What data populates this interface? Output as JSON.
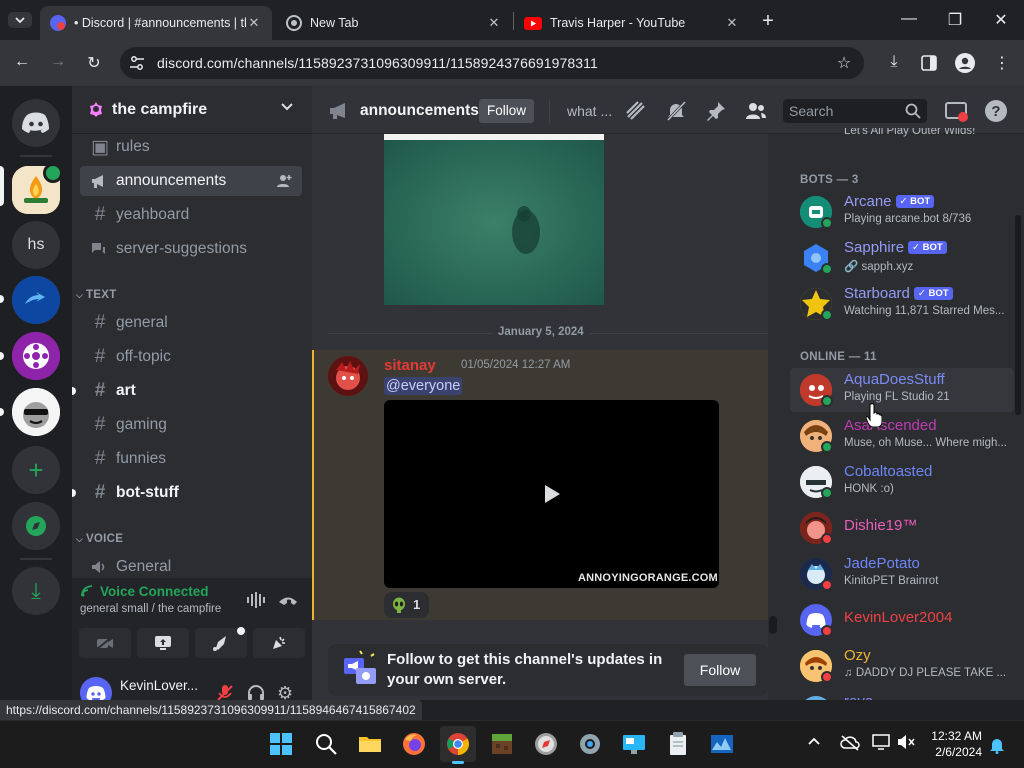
{
  "browser": {
    "tabs": [
      {
        "title": "• Discord | #announcements | the campfire",
        "active": true
      },
      {
        "title": "New Tab",
        "active": false
      },
      {
        "title": "Travis Harper - YouTube",
        "active": false
      }
    ],
    "url": "discord.com/channels/1158923731096309911/1158924376691978311",
    "hover_link": "https://discord.com/channels/1158923731096309911/1158946467415867402"
  },
  "server": {
    "name": "the campfire",
    "guild_labels": [
      "hs"
    ]
  },
  "channels": {
    "top": [
      {
        "name": "rules",
        "icon": "rules-icon"
      },
      {
        "name": "announcements",
        "icon": "megaphone-icon",
        "selected": true
      },
      {
        "name": "yeahboard",
        "icon": "hash-icon"
      },
      {
        "name": "server-suggestions",
        "icon": "forum-icon"
      }
    ],
    "text_category": "TEXT",
    "text": [
      {
        "name": "general",
        "unread": false
      },
      {
        "name": "off-topic",
        "unread": false
      },
      {
        "name": "art",
        "unread": true
      },
      {
        "name": "gaming",
        "unread": false
      },
      {
        "name": "funnies",
        "unread": false
      },
      {
        "name": "bot-stuff",
        "unread": true
      }
    ],
    "voice_category": "VOICE",
    "voice": [
      {
        "name": "General"
      }
    ]
  },
  "voice_status": {
    "title": "Voice Connected",
    "subtitle": "general small / the campfire"
  },
  "user": {
    "name": "KevinLover..."
  },
  "chat": {
    "channel_name": "announcements",
    "follow_label": "Follow",
    "topic": "what ...",
    "search_placeholder": "Search",
    "date_divider": "January 5, 2024",
    "message": {
      "author": "sitanay",
      "timestamp": "01/05/2024 12:27 AM",
      "mention": "@everyone",
      "video_watermark": "ANNOYINGORANGE.COM",
      "reaction_count": "1"
    },
    "follow_banner": {
      "text": "Follow to get this channel's updates in your own server.",
      "button": "Follow"
    }
  },
  "members": {
    "top_status": "Let's All Play Outer Wilds!",
    "bots_header": "BOTS — 3",
    "bots": [
      {
        "name": "Arcane",
        "status": "Playing arcane.bot 8/736",
        "badge": "BOT",
        "color": "#1abc9c"
      },
      {
        "name": "Sapphire",
        "status": "sapph.xyz",
        "badge": "BOT",
        "color": "#3b82f6"
      },
      {
        "name": "Starboard",
        "status": "Watching 11,871 Starred Mes...",
        "badge": "BOT",
        "color": "#f1c40f"
      }
    ],
    "online_header": "ONLINE — 11",
    "online": [
      {
        "name": "AquaDoesStuff",
        "status": "Playing FL Studio 21",
        "color": "#7c8cf5",
        "presence": "#23a55a",
        "avatar": "#e74c3c"
      },
      {
        "name": "AsaAscended",
        "status": "Muse, oh Muse... Where migh...",
        "color": "#c23bb4",
        "presence": "#23a55a",
        "avatar": "#e67e22"
      },
      {
        "name": "Cobaltoasted",
        "status": "HONK :o)",
        "color": "#6f86f7",
        "presence": "#23a55a",
        "avatar": "#dfe3ea"
      },
      {
        "name": "Dishie19™",
        "status": "",
        "color": "#eb5dbb",
        "presence": "#f23f43",
        "avatar": "#b03a2e"
      },
      {
        "name": "JadePotato",
        "status": "KinitoPET Brainrot",
        "color": "#6f86f7",
        "presence": "#f23f43",
        "avatar": "#2e4a7d"
      },
      {
        "name": "KevinLover2004",
        "status": "",
        "color": "#ed4245",
        "presence": "#f23f43",
        "avatar": "#5865f2"
      },
      {
        "name": "Ozy",
        "status": "DADDY DJ PLEASE TAKE ...",
        "color": "#f0b232",
        "presence": "#f23f43",
        "avatar": "#f39c12"
      },
      {
        "name": "reya",
        "status": "",
        "color": "#7c8cf5",
        "presence": "#23a55a",
        "avatar": "#5dade2"
      }
    ]
  },
  "taskbar": {
    "time": "12:32 AM",
    "date": "2/6/2024"
  }
}
